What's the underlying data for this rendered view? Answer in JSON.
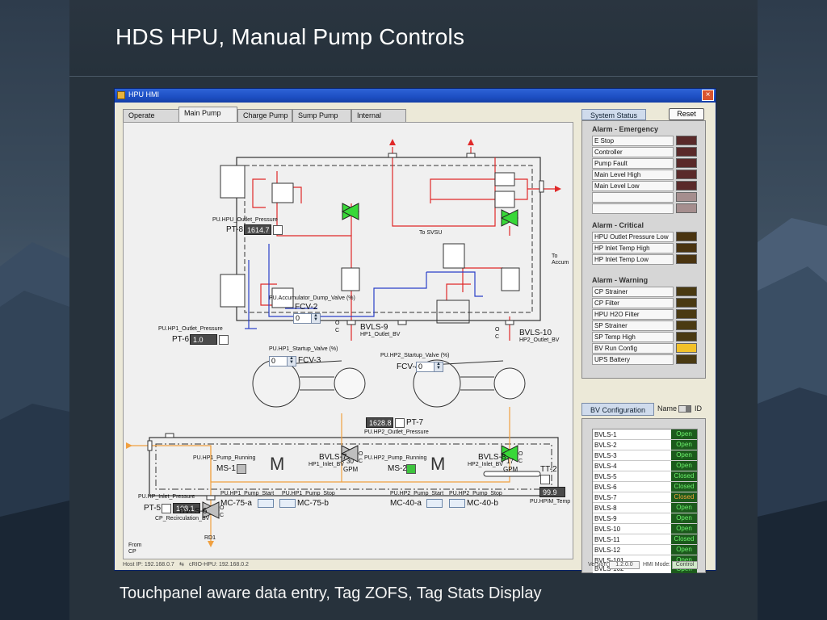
{
  "slide": {
    "title": "HDS HPU, Manual Pump Controls",
    "caption": "Touchpanel aware data entry, Tag ZOFS, Tag Stats Display"
  },
  "window": {
    "title": "HPU HMI",
    "close_symbol": "×"
  },
  "tabs": [
    {
      "label": "Operate",
      "active": false
    },
    {
      "label": "Main Pump",
      "active": true
    },
    {
      "label": "Charge Pump",
      "active": false
    },
    {
      "label": "Sump Pump",
      "active": false
    },
    {
      "label": "Internal",
      "active": false
    }
  ],
  "diagram": {
    "hpu_outlet": {
      "tag_name": "PU.HPU_Outlet_Pressure",
      "id": "PT-8",
      "value": "1614.7"
    },
    "to_svsu": "To SVSU",
    "to_accum_line1": "To",
    "to_accum_line2": "Accum",
    "fcv2": {
      "tag_name": "PU.Accumulator_Dump_Valve (%)",
      "id": "FCV-2",
      "value": "0"
    },
    "bvls9": {
      "id": "BVLS-9",
      "tag_name": "HP1_Outlet_BV"
    },
    "bvls10": {
      "id": "BVLS-10",
      "tag_name": "HP2_Outlet_BV"
    },
    "valve_o": "O",
    "valve_c": "C",
    "hp1_outlet": {
      "tag_name": "PU.HP1_Outlet_Pressure",
      "id": "PT-6",
      "value": "1.0"
    },
    "fcv3": {
      "tag_name": "PU.HP1_Startup_Valve (%)",
      "id": "FCV-3",
      "value": "0"
    },
    "fcv4": {
      "tag_name": "PU.HP2_Startup_Valve (%)",
      "id": "FCV-4",
      "value": "0"
    },
    "hp2_outlet": {
      "tag_name": "PU.HP2_Outlet_Pressure",
      "id": "PT-7",
      "value": "1628.8"
    },
    "pump1": {
      "running_tag": "PU.HP1_Pump_Running",
      "id": "MS-1",
      "gpm_value": "30",
      "gpm_unit": "GPM",
      "motor": "M",
      "running_color": "#bdbdbd"
    },
    "pump2": {
      "running_tag": "PU.HP2_Pump_Running",
      "id": "MS-2",
      "gpm_value": "17",
      "gpm_unit": "GPM",
      "motor": "M",
      "running_color": "#3ec43e"
    },
    "hp1_start": {
      "tag_name": "PU.HP1_Pump_Start",
      "id": "MC-75-a"
    },
    "hp1_stop": {
      "tag_name": "PU.HP1_Pump_Stop",
      "id": "MC-75-b"
    },
    "hp2_start": {
      "tag_name": "PU.HP2_Pump_Start",
      "id": "MC-40-a"
    },
    "hp2_stop": {
      "tag_name": "PU.HP2_Pump_Stop",
      "id": "MC-40-b"
    },
    "hp_inlet": {
      "tag_name": "PU.HP_Inlet_Pressure",
      "id": "PT-5",
      "value": "108.1"
    },
    "from_cp_line1": "From",
    "from_cp_line2": "CP",
    "bvls7": {
      "id": "BVLS-7",
      "tag_name": "HP1_Inlet_BV"
    },
    "bvls8": {
      "id": "BVLS-8",
      "tag_name": "HP2_Inlet_BV"
    },
    "tt2": {
      "id": "TT-2",
      "value": "99.9",
      "tag_name": "PU.HPIM_Temp"
    },
    "bvls6": {
      "id": "BVLS-6",
      "tag_name": "CP_Recirculation_BV"
    },
    "rd1": "RD1"
  },
  "system_status": {
    "tab_label": "System Status",
    "reset_label": "Reset",
    "groups": [
      {
        "title": "Alarm - Emergency",
        "items": [
          {
            "label": "E Stop",
            "color": "#5a2a2a"
          },
          {
            "label": "Controller",
            "color": "#5a2a2a"
          },
          {
            "label": "Pump Fault",
            "color": "#5a2a2a"
          },
          {
            "label": "Main Level High",
            "color": "#5a2a2a"
          },
          {
            "label": "Main Level Low",
            "color": "#5a2a2a"
          },
          {
            "label": "",
            "color": "#a58e8e"
          },
          {
            "label": "",
            "color": "#a58e8e"
          }
        ]
      },
      {
        "title": "Alarm - Critical",
        "items": [
          {
            "label": "HPU Outlet Pressure Low",
            "color": "#4a3410"
          },
          {
            "label": "HP Inlet Temp High",
            "color": "#4a3410"
          },
          {
            "label": "HP Inlet Temp Low",
            "color": "#4a3410"
          }
        ]
      },
      {
        "title": "Alarm - Warning",
        "items": [
          {
            "label": "CP Strainer",
            "color": "#4a3a12"
          },
          {
            "label": "CP Filter",
            "color": "#4a3a12"
          },
          {
            "label": "HPU H2O Filter",
            "color": "#4a3a12"
          },
          {
            "label": "SP Strainer",
            "color": "#4a3a12"
          },
          {
            "label": "SP Temp High",
            "color": "#4a3a12"
          },
          {
            "label": "BV Run Config",
            "color": "#f2c12a"
          },
          {
            "label": "UPS Battery",
            "color": "#4a3a12"
          }
        ]
      }
    ]
  },
  "bv_config": {
    "tab_label": "BV Configuration",
    "name_label": "Name",
    "id_label": "ID",
    "rows": [
      {
        "name": "BVLS-1",
        "state": "Open",
        "color": "#6cf26c"
      },
      {
        "name": "BVLS-2",
        "state": "Open",
        "color": "#6cf26c"
      },
      {
        "name": "BVLS-3",
        "state": "Open",
        "color": "#6cf26c"
      },
      {
        "name": "BVLS-4",
        "state": "Open",
        "color": "#6cf26c"
      },
      {
        "name": "BVLS-5",
        "state": "Closed",
        "color": "#6cf26c"
      },
      {
        "name": "BVLS-6",
        "state": "Closed",
        "color": "#6cf26c"
      },
      {
        "name": "BVLS-7",
        "state": "Closed",
        "color": "#f2a23a"
      },
      {
        "name": "BVLS-8",
        "state": "Open",
        "color": "#6cf26c"
      },
      {
        "name": "BVLS-9",
        "state": "Open",
        "color": "#6cf26c"
      },
      {
        "name": "BVLS-10",
        "state": "Open",
        "color": "#6cf26c"
      },
      {
        "name": "BVLS-11",
        "state": "Closed",
        "color": "#6cf26c"
      },
      {
        "name": "BVLS-12",
        "state": "Open",
        "color": "#6cf26c"
      },
      {
        "name": "BVLS-101",
        "state": "Open",
        "color": "#6cf26c"
      },
      {
        "name": "BVLS-102",
        "state": "Open",
        "color": "#6cf26c"
      }
    ]
  },
  "status_bar": {
    "host_ip": "Host IP: 192.168.0.7",
    "link_symbol": "⇆",
    "crio": "cRIO-HPU: 192.168.0.2",
    "version_label": "Version:",
    "version": "1.2.0.0",
    "mode_label": "HMI Mode:",
    "mode": "Control"
  }
}
